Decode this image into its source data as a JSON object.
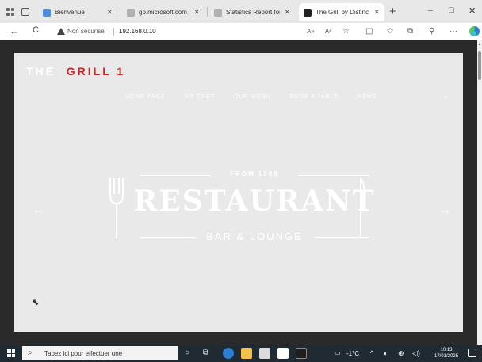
{
  "browser": {
    "tabs": [
      {
        "title": "Bienvenue",
        "active": false,
        "favicon_color": "#4a90d9"
      },
      {
        "title": "go.microsoft.com",
        "active": false,
        "favicon_color": "#b0b0b0"
      },
      {
        "title": "Statistics Report for H",
        "active": false,
        "favicon_color": "#b0b0b0"
      },
      {
        "title": "The Grill by Distinctiv",
        "active": true,
        "favicon_color": "#222222"
      }
    ],
    "new_tab_symbol": "+",
    "window_controls": {
      "minimize": "–",
      "maximize": "□",
      "close": "✕"
    },
    "address": {
      "back": "←",
      "reload": "C",
      "security_label": "Non sécurisé",
      "url": "192.168.0.10"
    },
    "toolbar_icons": [
      "read-aloud-icon",
      "font-icon",
      "favorite-icon",
      "split-screen-icon",
      "favorites-icon",
      "collections-icon",
      "extensions-icon",
      "more-icon",
      "edge-icon"
    ]
  },
  "site": {
    "brand_prefix": "THE",
    "brand_name": "GRILL 1",
    "menu": [
      "HOME PAGE",
      "MY CHEF",
      "OUR MENU",
      "BOOK A TABLE",
      "NEWS"
    ],
    "tagline": "FROM 1960",
    "headline": "RESTAURANT",
    "subline": "BAR & LOUNGE",
    "prev_arrow": "←",
    "next_arrow": "→",
    "colors": {
      "accent": "#c62828",
      "hero_bg": "#e9e9e9",
      "frame": "#2a2a2a"
    }
  },
  "taskbar": {
    "search_placeholder": "Tapez ici pour effectuer une",
    "weather": "-1°C",
    "time": "10:13",
    "date": "17/01/2025"
  }
}
